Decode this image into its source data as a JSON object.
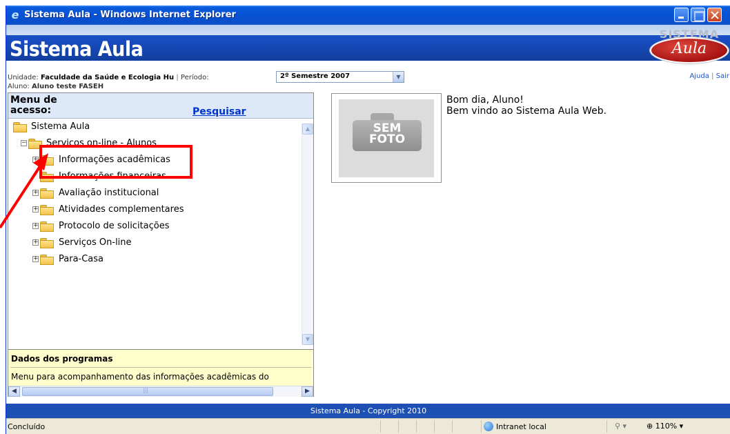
{
  "window": {
    "title": "Sistema Aula - Windows Internet Explorer",
    "min_label": "",
    "max_label": "",
    "close_label": ""
  },
  "header": {
    "site_title": "Sistema Aula",
    "logo_top": "SISTEMA",
    "logo_script": "Aula"
  },
  "info": {
    "unidade_label": "Unidade:",
    "unidade_value": "Faculdade da Saúde e Ecologia Hu",
    "separator": "|",
    "periodo_label": "Período:",
    "periodo_value": "2º Semestre 2007",
    "aluno_label": "Aluno:",
    "aluno_value": "Aluno teste FASEH",
    "help_link": "Ajuda",
    "links_sep": "|",
    "exit_link": "Sair"
  },
  "menu": {
    "title": "Menu de acesso:",
    "search_link": "Pesquisar",
    "tree": [
      {
        "label": "Sistema Aula",
        "expander": ""
      },
      {
        "label": "Serviços on-line - Alunos",
        "expander": "−"
      },
      {
        "label": "Informações acadêmicas",
        "expander": "+"
      },
      {
        "label": "Informações financeiras",
        "expander": ""
      },
      {
        "label": "Avaliação institucional",
        "expander": "+"
      },
      {
        "label": "Atividades complementares",
        "expander": "+"
      },
      {
        "label": "Protocolo de solicitações",
        "expander": "+"
      },
      {
        "label": "Serviços On-line",
        "expander": "+"
      },
      {
        "label": "Para-Casa",
        "expander": "+"
      }
    ]
  },
  "data_box": {
    "title": "Dados dos programas",
    "text": "Menu para acompanhamento das informações acadêmicas do"
  },
  "photo": {
    "placeholder_line1": "SEM",
    "placeholder_line2": "FOTO"
  },
  "welcome": {
    "line1": "Bom dia, Aluno!",
    "line2": "Bem vindo ao Sistema Aula Web."
  },
  "footer": {
    "copyright": "Sistema Aula - Copyright 2010"
  },
  "status": {
    "text": "Concluído",
    "zone": "Intranet local",
    "zoom": "110%"
  },
  "colors": {
    "annotation": "#ff0000",
    "header_blue": "#1a4fc8",
    "link_blue": "#0033cc"
  },
  "icons": {
    "folder": "folder-icon",
    "globe": "globe-icon",
    "ie": "ie-logo-icon"
  }
}
